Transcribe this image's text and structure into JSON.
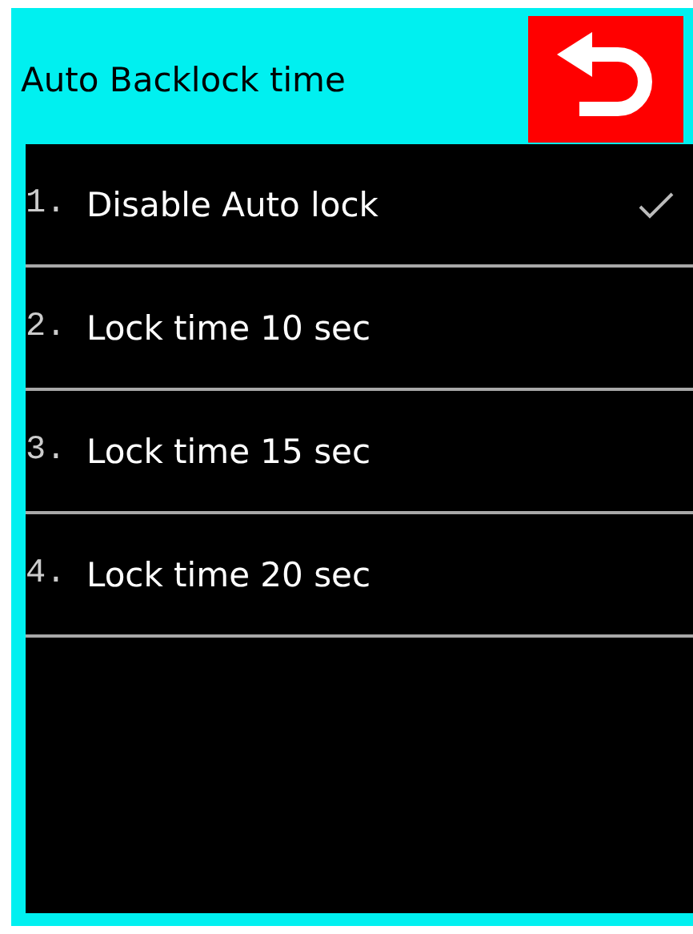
{
  "header": {
    "title": "Auto Backlock time"
  },
  "items": [
    {
      "number": "1.",
      "label": "Disable Auto lock",
      "selected": true
    },
    {
      "number": "2.",
      "label": "Lock time 10 sec",
      "selected": false
    },
    {
      "number": "3.",
      "label": "Lock time 15 sec",
      "selected": false
    },
    {
      "number": "4.",
      "label": "Lock time 20 sec",
      "selected": false
    }
  ]
}
